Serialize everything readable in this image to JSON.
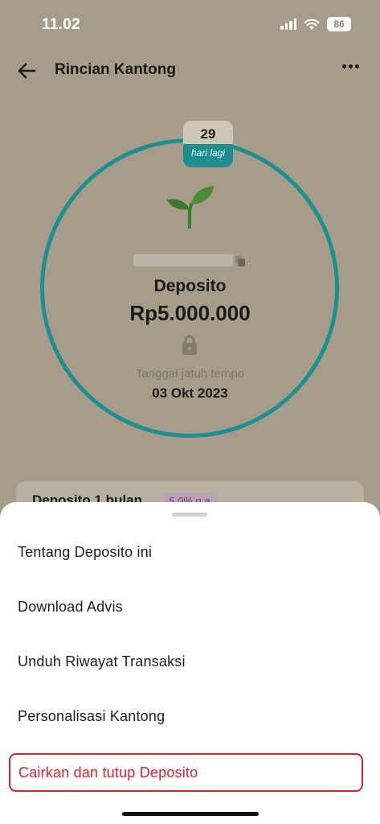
{
  "status_bar": {
    "time": "11.02",
    "battery": "86",
    "icons": [
      "signal-icon",
      "wifi-icon",
      "battery-icon"
    ]
  },
  "header": {
    "title": "Rincian Kantong",
    "back_icon": "arrow-left-icon",
    "more_icon": "more-dots-icon"
  },
  "pocket": {
    "days_left": "29",
    "days_label": "hari lagi",
    "product_name": "Deposito",
    "balance": "Rp5.000.000",
    "maturity_label": "Tanggal jatuh tempo",
    "maturity_date": "03 Okt 2023"
  },
  "detail_card": {
    "title": "Deposito 1 bulan",
    "rate": "5.0% p.a."
  },
  "menu": {
    "items": [
      {
        "label": "Tentang Deposito ini"
      },
      {
        "label": "Download Advis"
      },
      {
        "label": "Unduh Riwayat Transaksi"
      },
      {
        "label": "Personalisasi Kantong"
      },
      {
        "label": "Cairkan dan tutup Deposito"
      }
    ]
  },
  "colors": {
    "accent": "#1e8f90",
    "danger": "#d9232e",
    "overlay_background": "#a59c8a"
  }
}
